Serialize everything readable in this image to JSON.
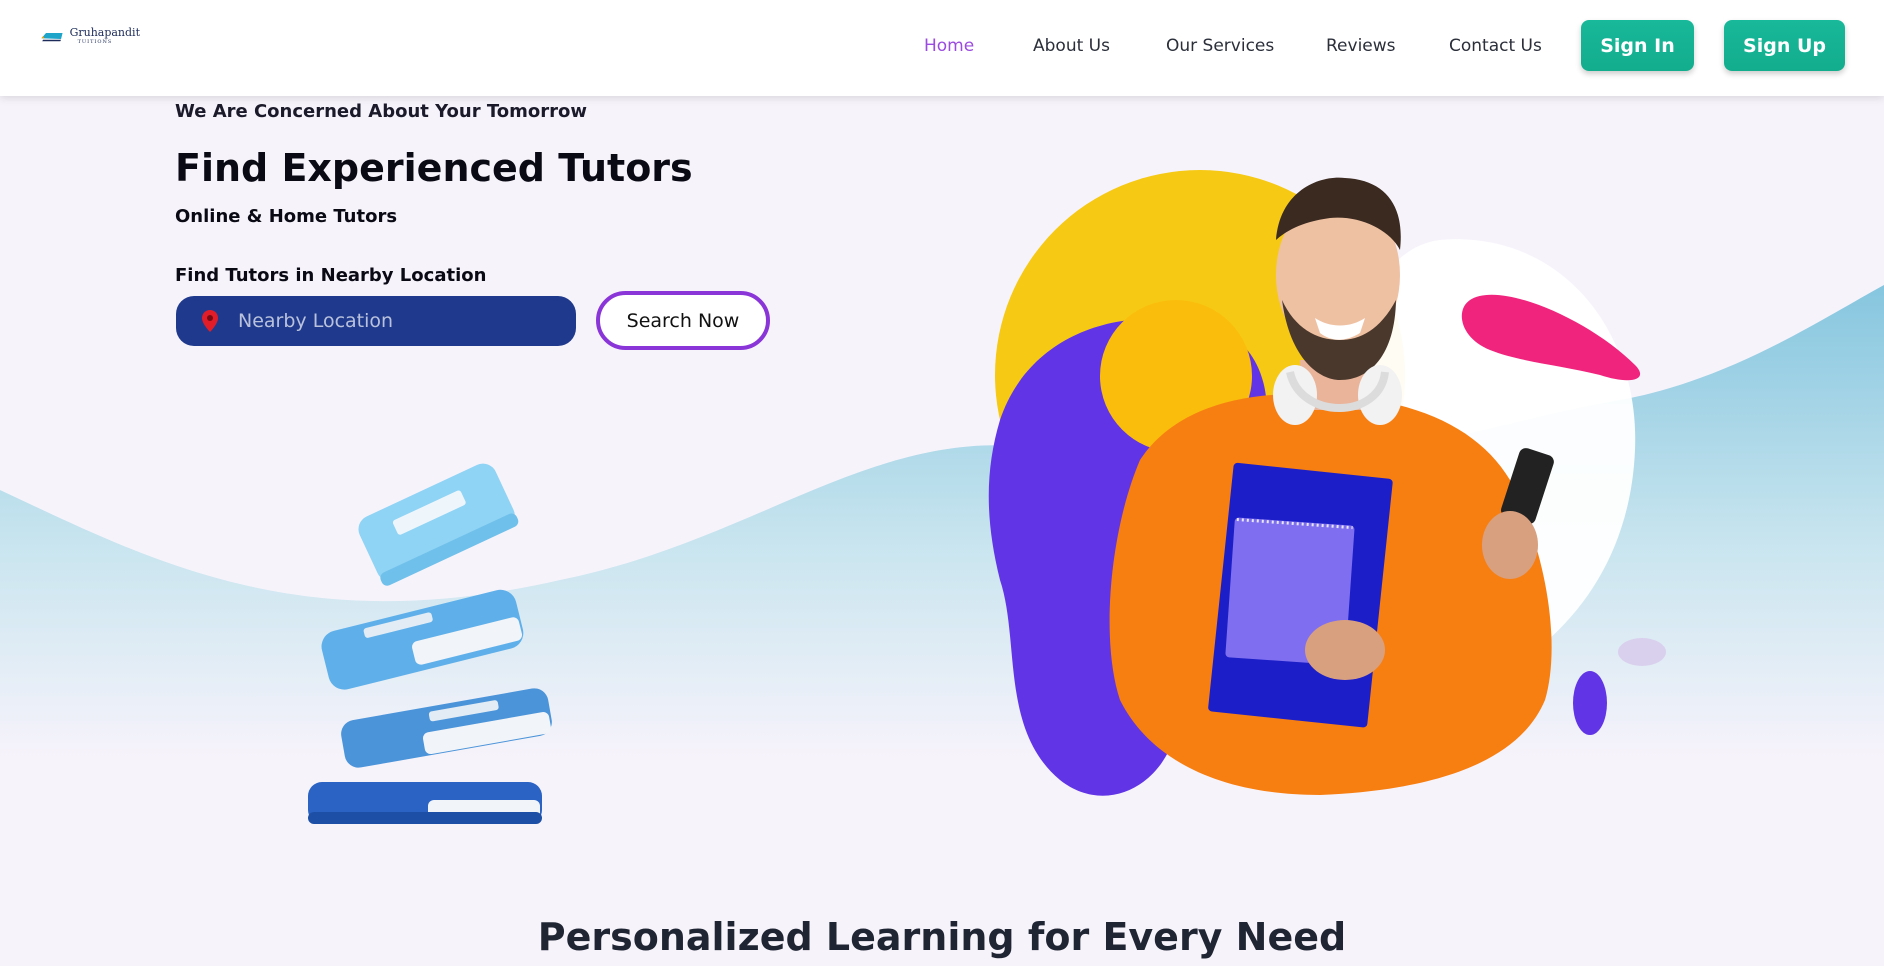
{
  "header": {
    "logo": {
      "title": "Gruhapandit",
      "subtitle": "TUITIONS"
    },
    "nav": [
      {
        "label": "Home",
        "active": true
      },
      {
        "label": "About Us",
        "active": false
      },
      {
        "label": "Our Services",
        "active": false
      },
      {
        "label": "Reviews",
        "active": false
      },
      {
        "label": "Contact Us",
        "active": false
      }
    ],
    "sign_in": "Sign In",
    "sign_up": "Sign Up"
  },
  "hero": {
    "tagline": "We Are Concerned About Your Tomorrow",
    "headline": "Find Experienced Tutors",
    "subline": "Online & Home Tutors",
    "find_label": "Find Tutors in Nearby Location",
    "location_placeholder": "Nearby Location",
    "search_button": "Search Now"
  },
  "section": {
    "heading": "Personalized Learning for Every Need"
  },
  "colors": {
    "active_nav": "#9b4be0",
    "button_green": "#14b394",
    "input_bg": "#1f3a8c",
    "search_border": "#8a35d8",
    "wave": "#8ccbe2"
  },
  "icons": [
    "location-pin-icon",
    "books-illustration",
    "student-photo"
  ]
}
